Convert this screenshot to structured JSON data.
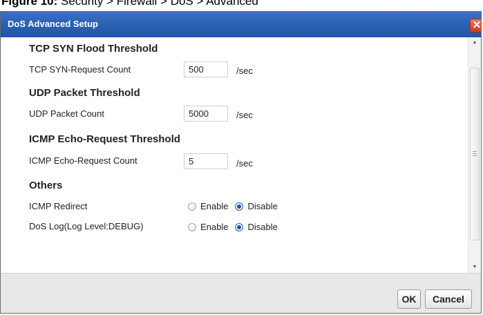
{
  "caption": {
    "figure_label": "Figure 10:",
    "path": "Security > Firewall > DoS > Advanced"
  },
  "dialog": {
    "title": "DoS Advanced Setup",
    "close_glyph": "✕"
  },
  "tcp_syn": {
    "heading": "TCP SYN Flood Threshold",
    "label": "TCP SYN-Request Count",
    "value": "500",
    "unit": "/sec"
  },
  "udp": {
    "heading": "UDP Packet Threshold",
    "label": "UDP Packet Count",
    "value": "5000",
    "unit": "/sec"
  },
  "icmp": {
    "heading": "ICMP Echo-Request Threshold",
    "label": "ICMP Echo-Request Count",
    "value": "5",
    "unit": "/sec"
  },
  "others": {
    "heading": "Others",
    "icmp_redirect": {
      "label": "ICMP Redirect",
      "enable_label": "Enable",
      "disable_label": "Disable",
      "selected": "Disable"
    },
    "dos_log": {
      "label": "DoS Log(Log Level:DEBUG)",
      "enable_label": "Enable",
      "disable_label": "Disable",
      "selected": "Disable"
    }
  },
  "footer": {
    "ok_label": "OK",
    "cancel_label": "Cancel"
  },
  "colors": {
    "titlebar": "#2a5fb1",
    "close_button": "#d8381e",
    "footer_bg": "#e8e8e8"
  },
  "icons": {
    "close": "close-icon",
    "scroll_up": "scroll-up-arrow-icon",
    "scroll_down": "scroll-down-arrow-icon"
  }
}
